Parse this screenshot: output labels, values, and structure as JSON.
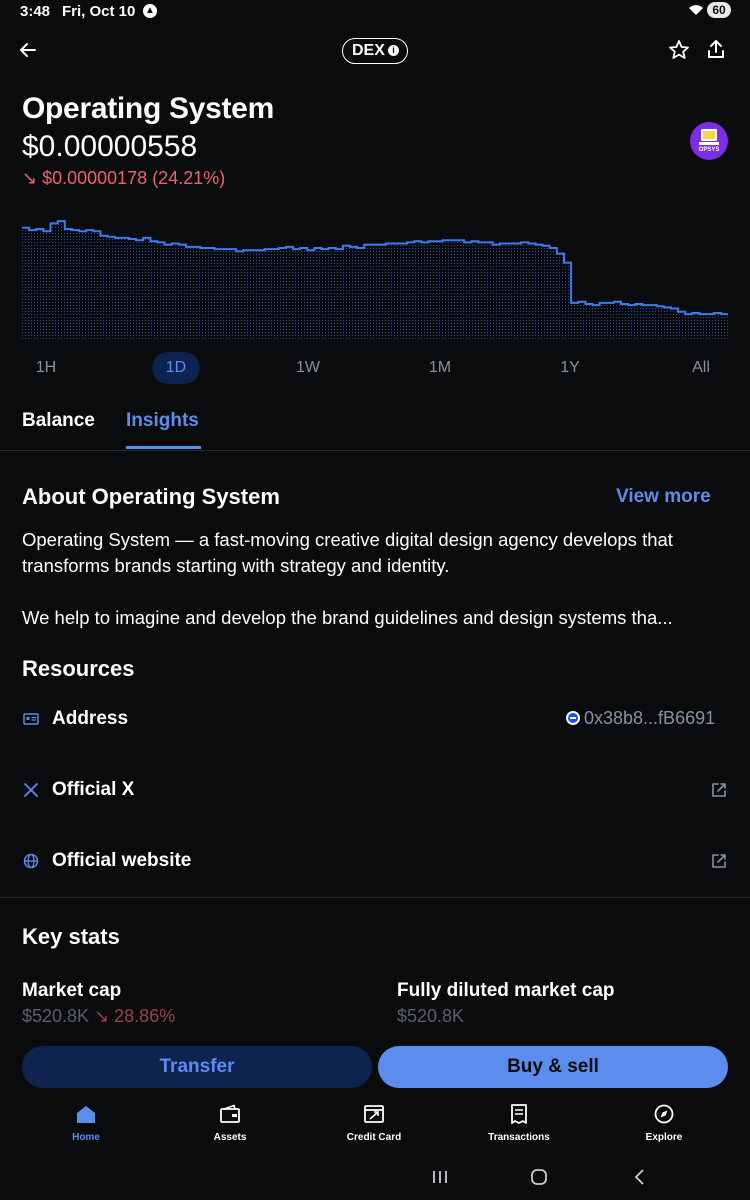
{
  "status_bar": {
    "time": "3:48",
    "date": "Fri, Oct 10",
    "battery": "60"
  },
  "header": {
    "badge": "DEX"
  },
  "asset": {
    "name": "Operating System",
    "price": "$0.00000558",
    "change": "↘ $0.00000178 (24.21%)",
    "logo_text": "OPSYS",
    "colors": {
      "accent": "#5b8def",
      "negative": "#f0616d",
      "background": "#0a0b0d"
    }
  },
  "chart_data": {
    "type": "line",
    "x": [
      0,
      1,
      2,
      3,
      4,
      5,
      6,
      7,
      8,
      9,
      10,
      11,
      12,
      13,
      14,
      15,
      16,
      17,
      18,
      19,
      20,
      21,
      22,
      23,
      24,
      25,
      26,
      27,
      28,
      29,
      30,
      31,
      32,
      33,
      34,
      35,
      36,
      37,
      38,
      39,
      40,
      41,
      42,
      43,
      44,
      45,
      46,
      47,
      48,
      49,
      50,
      51,
      52,
      53,
      54,
      55,
      56,
      57,
      58,
      59,
      60,
      61,
      62,
      63,
      64,
      65,
      66,
      67,
      68,
      69,
      70,
      71,
      72,
      73,
      74,
      75,
      76,
      77,
      78,
      79,
      80,
      81,
      82,
      83,
      84,
      85,
      86,
      87,
      88,
      89,
      90,
      91,
      92,
      93,
      94,
      95,
      96,
      97,
      98,
      99
    ],
    "values": [
      0.93,
      0.91,
      0.92,
      0.9,
      0.97,
      0.99,
      0.92,
      0.91,
      0.9,
      0.91,
      0.9,
      0.86,
      0.85,
      0.84,
      0.84,
      0.83,
      0.82,
      0.84,
      0.81,
      0.8,
      0.78,
      0.79,
      0.78,
      0.76,
      0.76,
      0.75,
      0.75,
      0.74,
      0.74,
      0.74,
      0.72,
      0.73,
      0.73,
      0.73,
      0.74,
      0.74,
      0.75,
      0.76,
      0.74,
      0.75,
      0.73,
      0.75,
      0.74,
      0.75,
      0.74,
      0.77,
      0.76,
      0.75,
      0.78,
      0.78,
      0.78,
      0.79,
      0.79,
      0.79,
      0.8,
      0.81,
      0.8,
      0.81,
      0.81,
      0.82,
      0.82,
      0.82,
      0.8,
      0.81,
      0.8,
      0.8,
      0.78,
      0.79,
      0.79,
      0.79,
      0.8,
      0.79,
      0.78,
      0.77,
      0.75,
      0.7,
      0.62,
      0.26,
      0.27,
      0.25,
      0.24,
      0.26,
      0.26,
      0.27,
      0.25,
      0.24,
      0.25,
      0.24,
      0.24,
      0.23,
      0.22,
      0.21,
      0.18,
      0.16,
      0.17,
      0.16,
      0.16,
      0.17,
      0.16,
      0.15
    ],
    "ylim": [
      0,
      1.0
    ],
    "grid": false,
    "legend": "none"
  },
  "ranges": [
    "1H",
    "1D",
    "1W",
    "1M",
    "1Y",
    "All"
  ],
  "active_range": "1D",
  "tabs": {
    "balance": "Balance",
    "insights": "Insights"
  },
  "about": {
    "title": "About Operating System",
    "view_more": "View more",
    "paragraph1": "Operating System — a fast-moving creative digital design agency develops that transforms brands starting with strategy and identity.",
    "paragraph2": "We help to imagine and develop the brand guidelines and design systems tha..."
  },
  "resources": {
    "title": "Resources",
    "address_label": "Address",
    "address_value": "0x38b8...fB6691",
    "x_label": "Official X",
    "website_label": "Official website"
  },
  "key_stats": {
    "title": "Key stats",
    "market_cap_label": "Market cap",
    "market_cap_value": "$520.8K",
    "market_cap_change": "↘ 28.86%",
    "fdmc_label": "Fully diluted market cap",
    "fdmc_value": "$520.8K"
  },
  "actions": {
    "transfer": "Transfer",
    "buy_sell": "Buy & sell"
  },
  "bottom_nav": {
    "home": "Home",
    "assets": "Assets",
    "credit_card": "Credit Card",
    "transactions": "Transactions",
    "explore": "Explore"
  }
}
